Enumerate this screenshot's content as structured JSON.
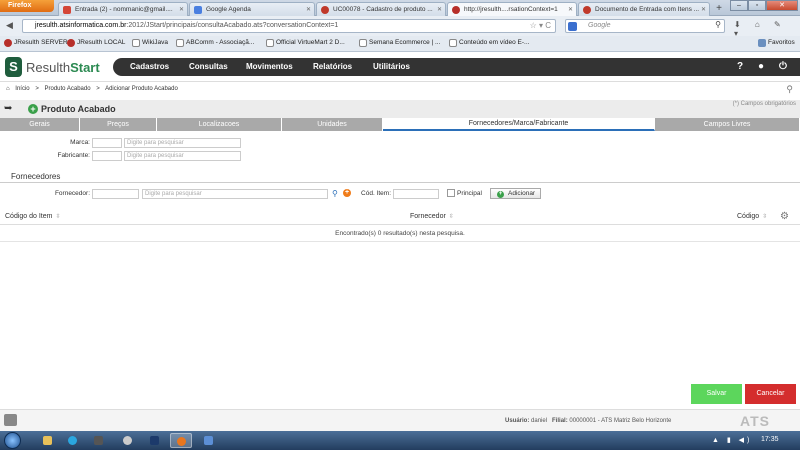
{
  "browser": {
    "menu_button": "Firefox",
    "tabs": [
      {
        "title": "Entrada (2) - nommanic@gmail....",
        "icon": "gmail-icon"
      },
      {
        "title": "Google Agenda",
        "icon": "calendar-icon"
      },
      {
        "title": "UC00078 - Cadastro de produto ...",
        "icon": "page-icon"
      },
      {
        "title": "http://jresulth....rsationContext=1",
        "icon": "resulth-icon"
      },
      {
        "title": "Documento de Entrada com Itens ...",
        "icon": "page-icon"
      }
    ],
    "new_tab": "+",
    "url_host": "jresulth.atsinformatica.com.br",
    "url_rest": ":2012/JStart/principais/consultaAcabado.ats?conversationContext=1",
    "search_placeholder": "Google",
    "bookmarks": [
      "JResulth SERVER",
      "JResulth LOCAL",
      "WikiJava",
      "ABComm - Associaçã...",
      "Official VirtueMart 2 D...",
      "Semana Ecommerce | ...",
      "Conteúdo em vídeo E-..."
    ],
    "bookmarks_menu": "Favoritos"
  },
  "app": {
    "logo_mark": "S",
    "logo_prefix": "Resulth",
    "logo_suffix": "Start",
    "menu": [
      "Cadastros",
      "Consultas",
      "Movimentos",
      "Relatórios",
      "Utilitários"
    ],
    "help": "?"
  },
  "breadcrumb": [
    "Início",
    ">",
    "Produto Acabado",
    ">",
    "Adicionar Produto Acabado"
  ],
  "page": {
    "title": "Produto Acabado",
    "required_note": "(*) Campos obrigatórios"
  },
  "form_tabs": [
    "Gerais",
    "Preços",
    "Localizacoes",
    "Unidades",
    "Fornecedores/Marca/Fabricante",
    "Campos Livres"
  ],
  "fields": {
    "marca_label": "Marca:",
    "marca_placeholder": "Digite para pesquisar",
    "fabricante_label": "Fabricante:",
    "fabricante_placeholder": "Digite para pesquisar"
  },
  "fornecedores": {
    "title": "Fornecedores",
    "fornecedor_label": "Fornecedor:",
    "fornecedor_placeholder": "Digite para pesquisar",
    "cod_item_label": "Cód. Item:",
    "principal_label": "Principal",
    "add_button": "Adicionar",
    "columns": [
      "Código do Item",
      "Fornecedor",
      "Código"
    ],
    "empty_message": "Encontrado(s) 0 resultado(s) nesta pesquisa."
  },
  "actions": {
    "save": "Salvar",
    "cancel": "Cancelar"
  },
  "status": {
    "user_label": "Usuário:",
    "user": "daniel",
    "branch_label": "Filial:",
    "branch": "00000001 - ATS Matriz Belo Horizonte",
    "brand": "ATS"
  },
  "taskbar": {
    "clock": "17:35"
  }
}
